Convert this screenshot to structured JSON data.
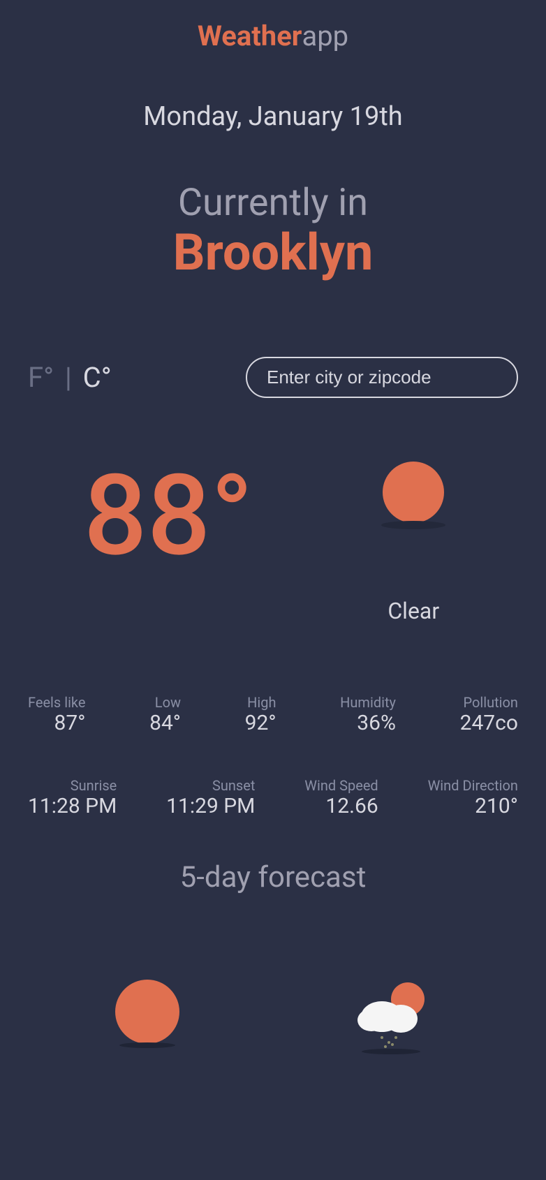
{
  "logo": {
    "bold": "Weather",
    "light": "app"
  },
  "date": "Monday, January 19th",
  "header": {
    "currently": "Currently in",
    "city": "Brooklyn"
  },
  "units": {
    "f": "F°",
    "sep": "|",
    "c": "C°"
  },
  "search": {
    "placeholder": "Enter city or zipcode"
  },
  "current": {
    "temp": "88°",
    "condition": "Clear",
    "icon": "sun"
  },
  "stats_row1": [
    {
      "label": "Feels like",
      "value": "87°"
    },
    {
      "label": "Low",
      "value": "84°"
    },
    {
      "label": "High",
      "value": "92°"
    },
    {
      "label": "Humidity",
      "value": "36%"
    },
    {
      "label": "Pollution",
      "value": "247co"
    }
  ],
  "stats_row2": [
    {
      "label": "Sunrise",
      "value": "11:28 PM"
    },
    {
      "label": "Sunset",
      "value": "11:29 PM"
    },
    {
      "label": "Wind Speed",
      "value": "12.66"
    },
    {
      "label": "Wind Direction",
      "value": "210°"
    }
  ],
  "forecast": {
    "title": "5-day forecast",
    "items": [
      {
        "icon": "sun"
      },
      {
        "icon": "rain-sun"
      }
    ]
  },
  "colors": {
    "accent": "#e07050",
    "bg": "#2b3045"
  }
}
